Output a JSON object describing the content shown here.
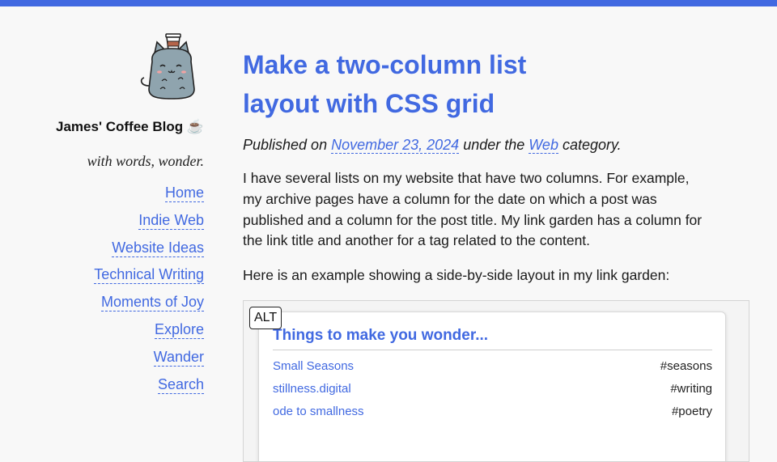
{
  "blog": {
    "title": "James' Coffee Blog ☕",
    "tagline": "with words, wonder."
  },
  "nav": [
    {
      "label": "Home"
    },
    {
      "label": "Indie Web"
    },
    {
      "label": "Website Ideas"
    },
    {
      "label": "Technical Writing"
    },
    {
      "label": "Moments of Joy"
    },
    {
      "label": "Explore"
    },
    {
      "label": "Wander"
    },
    {
      "label": "Search"
    }
  ],
  "post": {
    "title": "Make a two-column list layout with CSS grid",
    "meta_prefix": "Published on ",
    "date": "November 23, 2024",
    "meta_middle": " under the ",
    "category": "Web",
    "meta_suffix": " category.",
    "paragraphs": [
      "I have several lists on my website that have two columns. For example, my archive pages have a column for the date on which a post was published and a column for the post title. My link garden has a column for the link title and another for a tag related to the content.",
      "Here is an example showing a side-by-side layout in my link garden:"
    ]
  },
  "figure": {
    "alt_badge": "ALT",
    "heading": "Things to make you wonder...",
    "rows": [
      {
        "link": "Small Seasons",
        "tag": "#seasons"
      },
      {
        "link": "stillness.digital",
        "tag": "#writing"
      },
      {
        "link": "ode to smallness",
        "tag": "#poetry"
      }
    ]
  },
  "colors": {
    "accent": "#4169e1",
    "background": "#f8f8f8",
    "text": "#1a1a1a"
  }
}
